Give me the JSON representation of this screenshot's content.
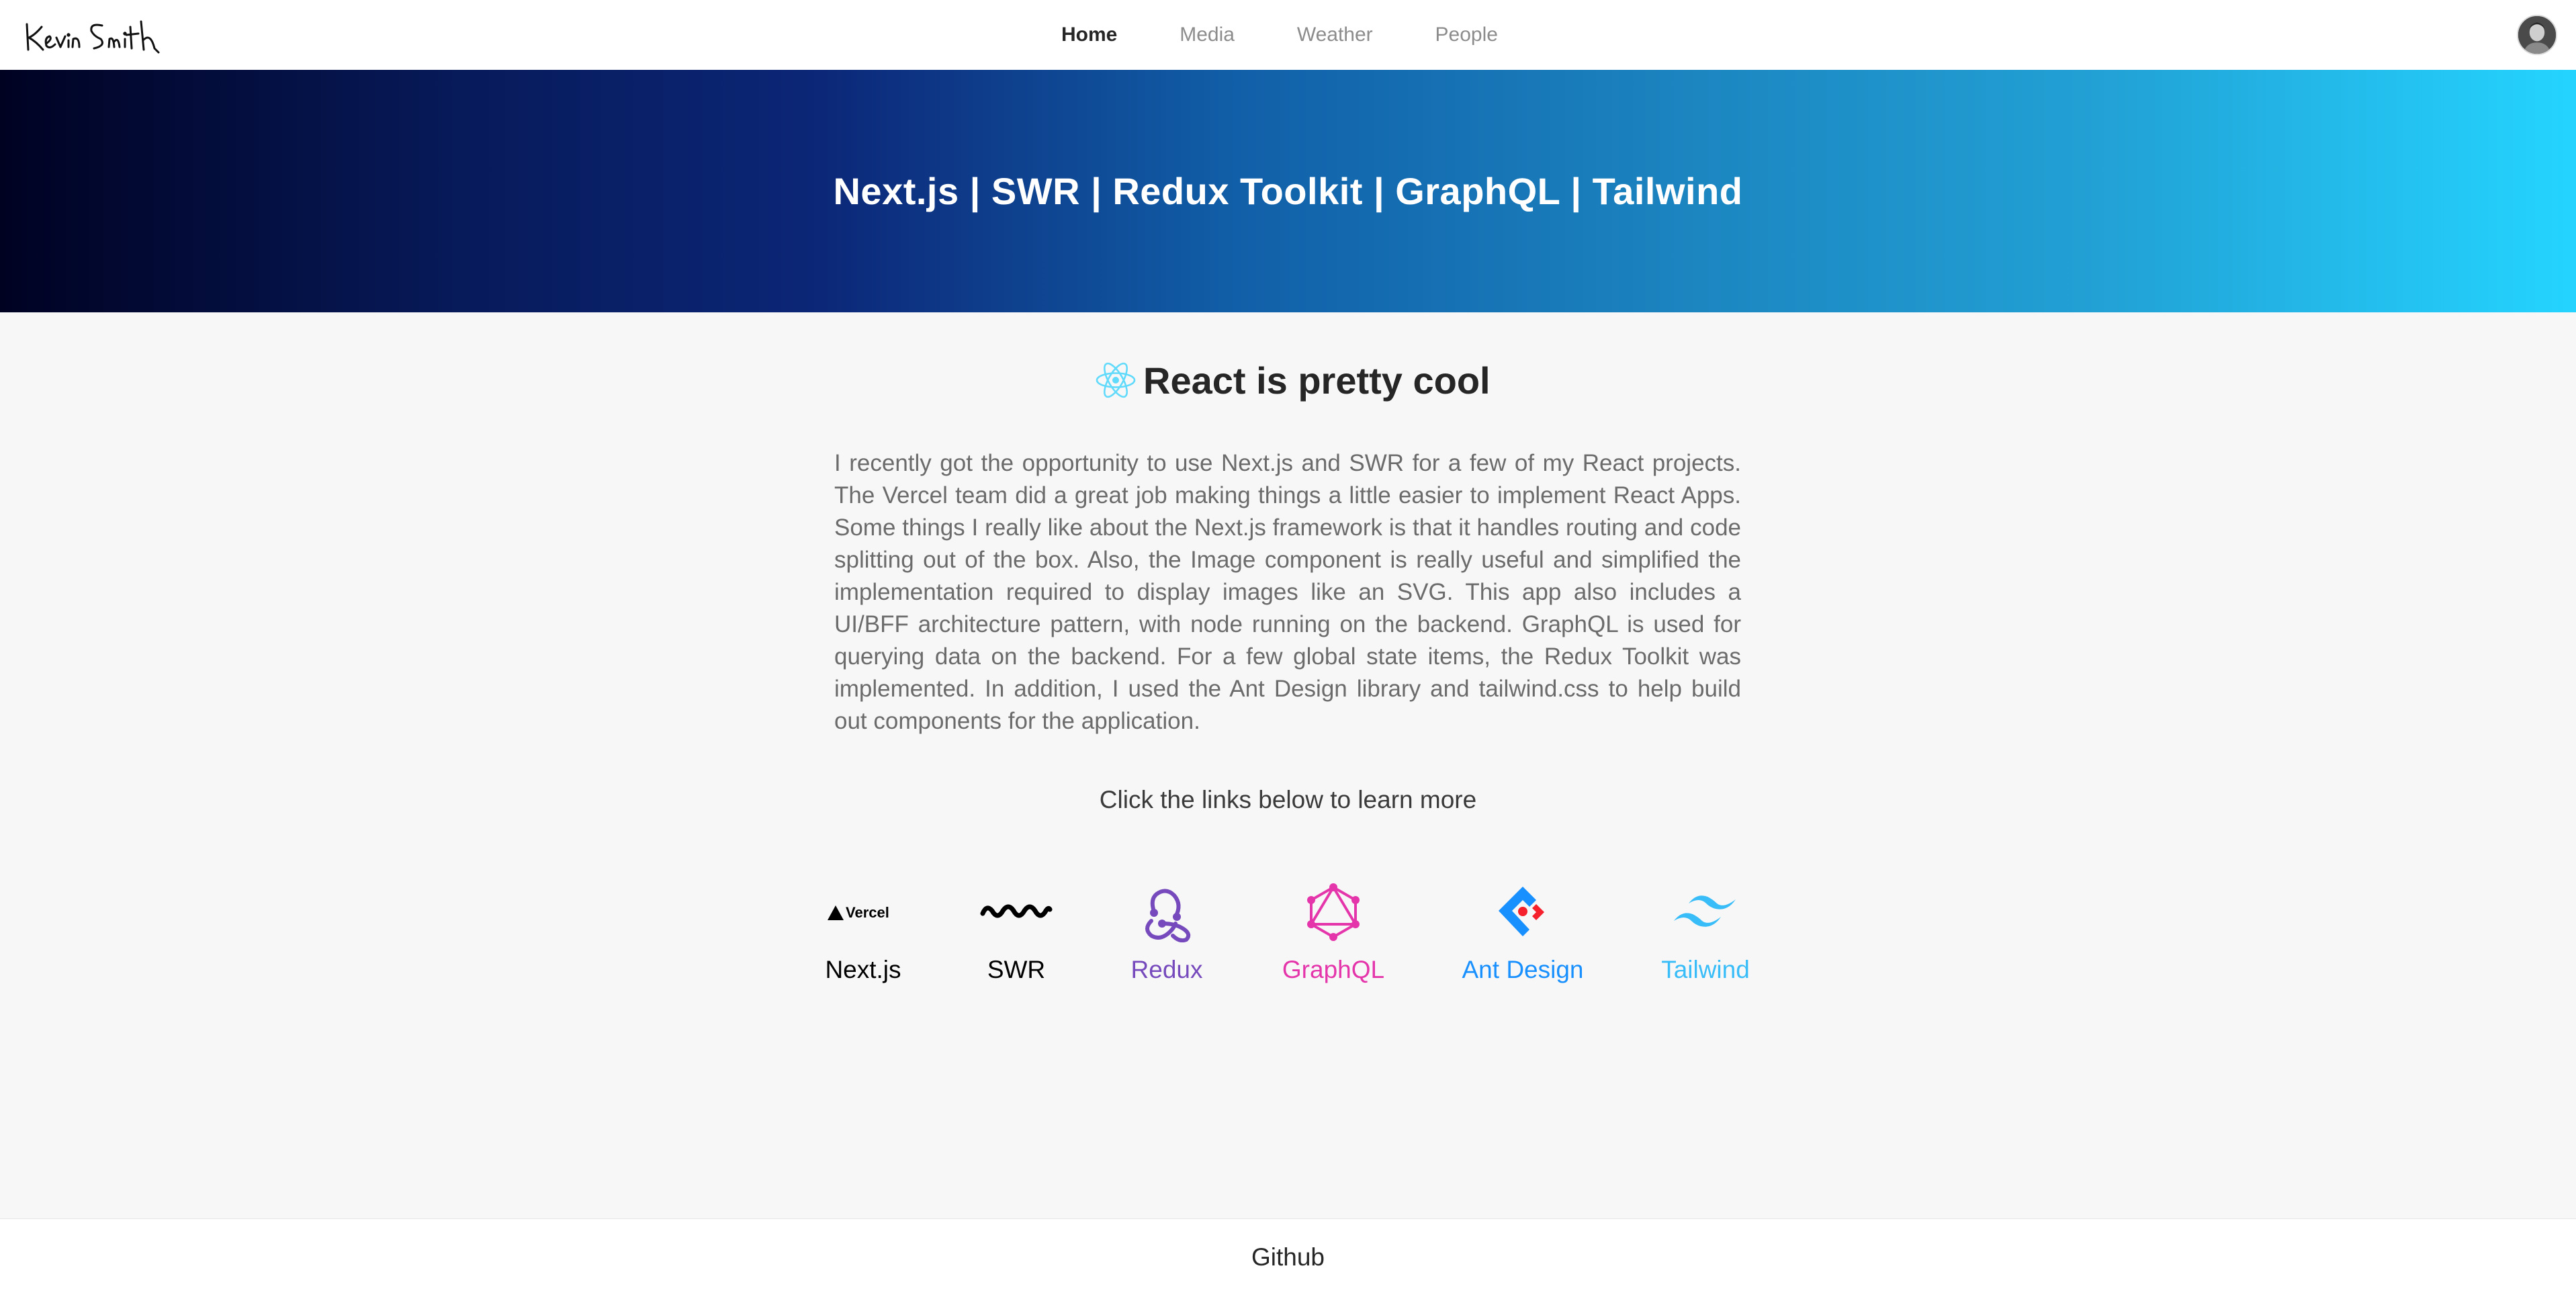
{
  "header": {
    "logo_text": "Kevin Smith",
    "nav": [
      {
        "label": "Home",
        "active": true
      },
      {
        "label": "Media",
        "active": false
      },
      {
        "label": "Weather",
        "active": false
      },
      {
        "label": "People",
        "active": false
      }
    ]
  },
  "hero": {
    "title": "Next.js | SWR | Redux Toolkit | GraphQL | Tailwind"
  },
  "main": {
    "heading_icon": "react-icon",
    "heading": "React is pretty cool",
    "intro": "I recently got the opportunity to use Next.js and SWR for a few of my React projects. The Vercel team did a great job making things a little easier to implement React Apps. Some things I really like about the Next.js framework is that it handles routing and code splitting out of the box. Also, the Image component is really useful and simplified the implementation required to display images like an SVG. This app also includes a UI/BFF architecture pattern, with node running on the backend. GraphQL is used for querying data on the backend. For a few global state items, the Redux Toolkit was implemented. In addition, I used the Ant Design library and tailwind.css to help build out components for the application.",
    "links_caption": "Click the links below to learn more",
    "links": [
      {
        "label": "Next.js",
        "icon": "vercel-logo-icon",
        "icon_text": "Vercel",
        "color": "#000000"
      },
      {
        "label": "SWR",
        "icon": "swr-logo-icon",
        "color": "#000000"
      },
      {
        "label": "Redux",
        "icon": "redux-logo-icon",
        "color": "#764abc"
      },
      {
        "label": "GraphQL",
        "icon": "graphql-logo-icon",
        "color": "#e535ab"
      },
      {
        "label": "Ant Design",
        "icon": "ant-design-logo-icon",
        "color": "#1890ff"
      },
      {
        "label": "Tailwind",
        "icon": "tailwind-logo-icon",
        "color": "#38bdf8"
      }
    ]
  },
  "footer": {
    "link": "Github"
  }
}
